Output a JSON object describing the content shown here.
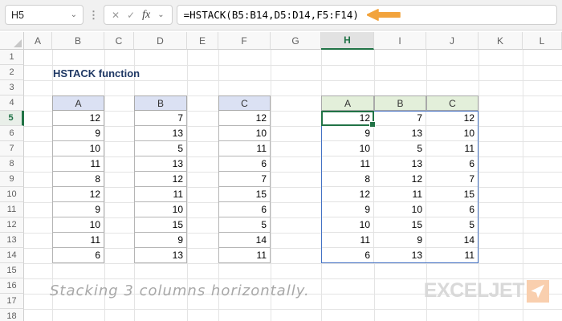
{
  "formula_bar": {
    "cell_reference": "H5",
    "name_box_chevron": "⌄",
    "cancel_label": "✕",
    "enter_label": "✓",
    "fx_label": "fx",
    "fx_chevron": "⌄",
    "formula": "=HSTACK(B5:B14,D5:D14,F5:F14)"
  },
  "grid": {
    "column_headers": [
      "A",
      "B",
      "C",
      "D",
      "E",
      "F",
      "G",
      "H",
      "I",
      "J",
      "K",
      "L"
    ],
    "selected_column": "H",
    "row_count": 18,
    "selected_row": 5
  },
  "content": {
    "title": "HSTACK function",
    "caption": "Stacking 3 columns horizontally.",
    "source_tables": [
      {
        "header": "A",
        "values": [
          12,
          9,
          10,
          11,
          8,
          12,
          9,
          10,
          11,
          6
        ]
      },
      {
        "header": "B",
        "values": [
          7,
          13,
          5,
          13,
          12,
          11,
          10,
          15,
          9,
          13
        ]
      },
      {
        "header": "C",
        "values": [
          12,
          10,
          11,
          6,
          7,
          15,
          6,
          5,
          14,
          11
        ]
      }
    ],
    "result_table": {
      "headers": [
        "A",
        "B",
        "C"
      ],
      "rows": [
        [
          12,
          7,
          12
        ],
        [
          9,
          13,
          10
        ],
        [
          10,
          5,
          11
        ],
        [
          11,
          13,
          6
        ],
        [
          8,
          12,
          7
        ],
        [
          12,
          11,
          15
        ],
        [
          9,
          10,
          6
        ],
        [
          10,
          15,
          5
        ],
        [
          11,
          9,
          14
        ],
        [
          6,
          13,
          11
        ]
      ]
    }
  },
  "logo": {
    "text": "EXCELJET",
    "arrow_icon": "paper-plane-arrow"
  },
  "colors": {
    "selection_green": "#217346",
    "spill_blue": "#4472c4",
    "source_header_bg": "#dbe1f3",
    "result_header_bg": "#e3efda",
    "accent_orange": "#f2a33c",
    "title_navy": "#1f3864",
    "logo_orange": "#f9cfae"
  }
}
